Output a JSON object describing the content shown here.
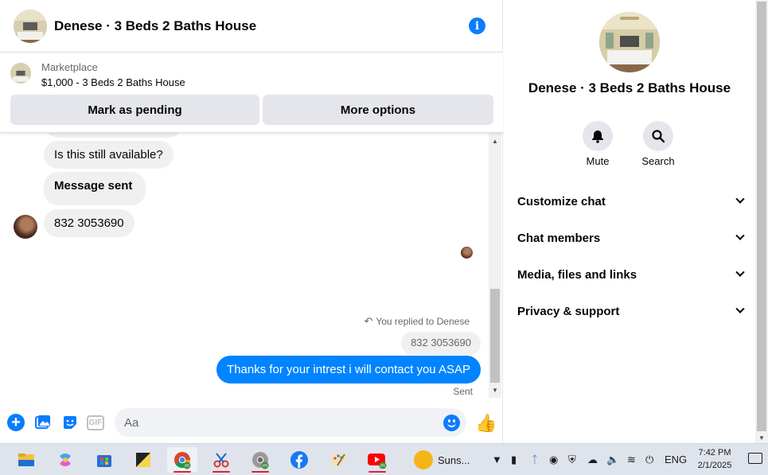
{
  "chat": {
    "title": "Denese · 3 Beds 2 Baths House",
    "info_icon": "info-icon",
    "marketplace": {
      "kicker": "Marketplace",
      "item": "$1,000 - 3 Beds 2 Baths House",
      "pending_button": "Mark as pending",
      "more_button": "More options"
    },
    "messages": [
      {
        "direction": "in",
        "text": "Is this still available?"
      },
      {
        "direction": "in",
        "text": "Message sent"
      },
      {
        "direction": "in",
        "text": "832 3053690"
      }
    ],
    "reply_indicator": "You replied to Denese",
    "quoted_message": "832 3053690",
    "outgoing_message": "Thanks for your intrest i will contact you ASAP",
    "status": "Sent",
    "composer": {
      "placeholder": "Aa"
    }
  },
  "info_panel": {
    "name": "Denese · 3 Beds 2 Baths House",
    "actions": {
      "mute": "Mute",
      "search": "Search"
    },
    "sections": [
      "Customize chat",
      "Chat members",
      "Media, files and links",
      "Privacy & support"
    ]
  },
  "taskbar": {
    "weather_text": "Suns...",
    "language": "ENG",
    "time": "7:42 PM",
    "date": "2/1/2025"
  },
  "colors": {
    "accent": "#0084ff",
    "bubble_incoming": "#f0f0f0",
    "button_bg": "#e4e6eb"
  }
}
